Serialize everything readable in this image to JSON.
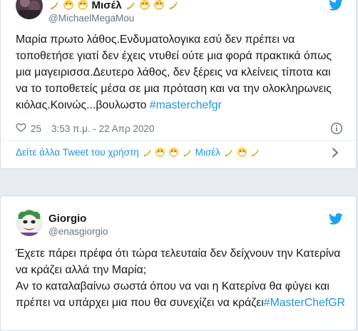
{
  "tweet1": {
    "author_name": "Μισέλ",
    "handle": "@MichaelMegaMou",
    "text_main": "Μαρία πρωτο λάθος.Ενδυματολογικα εσύ δεν πρέπει να τοποθετήσε γιατί δεν έχεις ντυθεί ούτε μια φορά πρακτικά όπως μια μαγειρισσα.Δευτερο λάθος, δεν ξέρεις να κλείνεις τίποτα και να το τοποθετείς μέσα σε μια πρόταση και να την ολοκληρωνεις κιόλας.Κοινώς...βουλωστο ",
    "hashtag": "#masterchefgr",
    "likes": "25",
    "timestamp": "3:53 π.μ. - 22 Απρ 2020",
    "see_more_prefix": "Δείτε άλλα Tweet του χρήστη ",
    "see_more_name": "Μισέλ",
    "icons": [
      "avatar",
      "banana-emoji",
      "face-mask-emoji",
      "twitter-bird-icon",
      "heart-icon",
      "info-icon",
      "chevron-right-icon"
    ]
  },
  "tweet2": {
    "author_name": "Giorgio",
    "handle": "@enasgiorgio",
    "text_main": "Έχετε πάρει πρέφα ότι τώρα τελευταία δεν δείχνουν την Κατερίνα να κράζει αλλά την Μαρία;\nΑν το καταλαβαίνω σωστά όπου να ναι η Κατερίνα θα φύγει και πρέπει να υπάρχει μια που θα συνεχίζει να κράζει",
    "hashtag": "#MasterChefGR",
    "icons": [
      "joker-avatar",
      "twitter-bird-icon"
    ]
  },
  "colors": {
    "link": "#1b95e0",
    "text": "#14171a",
    "muted": "#657786",
    "background": "#e6ecf0"
  }
}
